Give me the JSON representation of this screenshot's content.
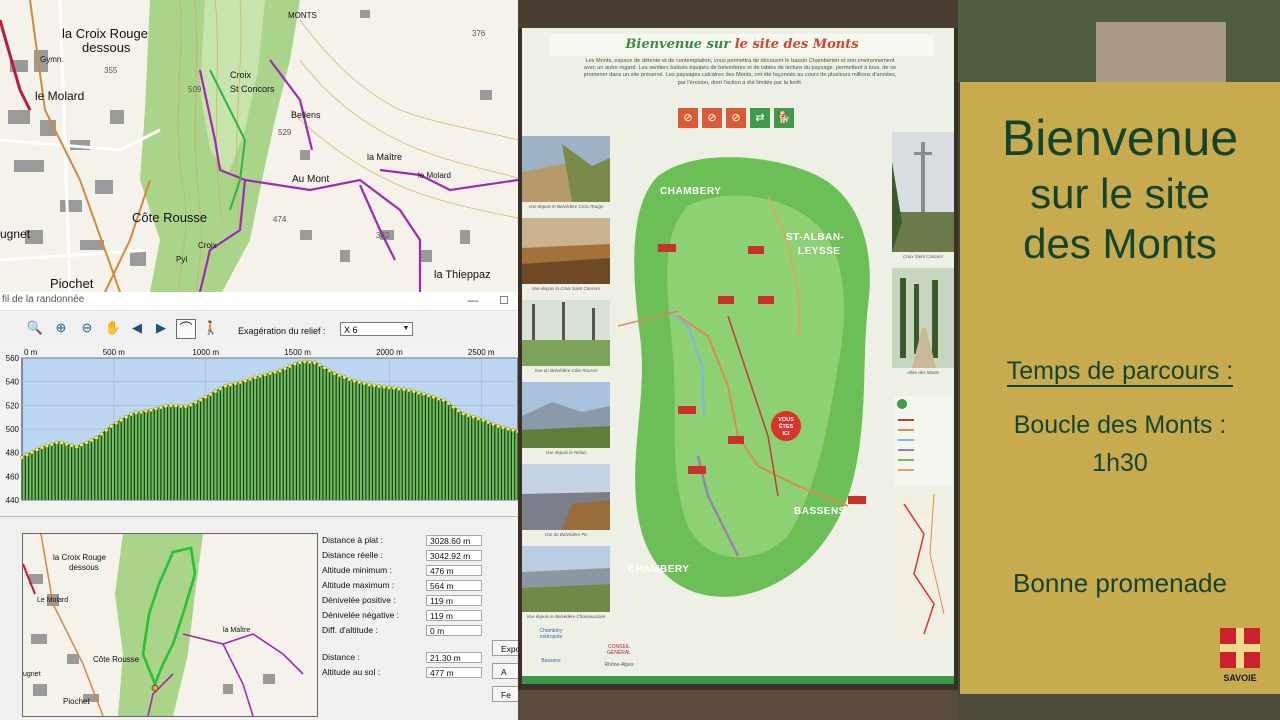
{
  "window": {
    "title": "fil de la randonnée"
  },
  "topmap": {
    "labels": [
      "la Croix Rouge",
      "dessous",
      "le Molard",
      "Croix",
      "St Concors",
      "Bellens",
      "la Maître",
      "Au Mont",
      "le Molard",
      "Côte Rousse",
      "Croix",
      "Pyl",
      "Piochet",
      "la Thieppaz",
      "Gymn.",
      "MONTS",
      "ugnet"
    ],
    "elevations": [
      "355",
      "375",
      "376",
      "509",
      "529",
      "474",
      "382",
      "290",
      "300"
    ]
  },
  "toolbar": {
    "exag_label": "Exagération du relief :",
    "exag_value": "X 6",
    "icons": [
      "zoom-in-icon",
      "zoom-region-icon",
      "zoom-out-icon",
      "pan-hand-icon",
      "arrow-left-icon",
      "arrow-right-icon",
      "profile-mode-icon",
      "walker-icon"
    ]
  },
  "chart_data": {
    "type": "area",
    "x_unit": "m",
    "y_unit": "m",
    "x_ticks": [
      "0 m",
      "500 m",
      "1000 m",
      "1500 m",
      "2000 m",
      "2500 m"
    ],
    "y_ticks": [
      "560",
      "540",
      "520",
      "500",
      "480",
      "460",
      "440"
    ],
    "ylim": [
      440,
      560
    ],
    "xlim": [
      0,
      2700
    ],
    "series": [
      {
        "x": [
          0,
          100,
          200,
          300,
          400,
          500,
          600,
          700,
          800,
          900,
          1000,
          1100,
          1200,
          1300,
          1400,
          1500,
          1550,
          1600,
          1700,
          1800,
          1900,
          2000,
          2100,
          2200,
          2300,
          2400,
          2500,
          2600,
          2700
        ],
        "y": [
          476,
          484,
          489,
          485,
          492,
          504,
          513,
          516,
          520,
          519,
          527,
          536,
          540,
          545,
          549,
          556,
          557,
          556,
          547,
          541,
          537,
          535,
          533,
          529,
          524,
          513,
          508,
          502,
          498
        ]
      }
    ],
    "fill_color": "#6fbd5e",
    "point_color": "#f3f05a",
    "background": "#bcd6f2",
    "grid": true
  },
  "stats": [
    {
      "label": "Distance à plat :",
      "value": "3028.60 m"
    },
    {
      "label": "Distance réelle :",
      "value": "3042.92 m"
    },
    {
      "label": "Altitude minimum :",
      "value": "476 m"
    },
    {
      "label": "Altitude maximum :",
      "value": "564 m"
    },
    {
      "label": "Dénivelée positive :",
      "value": "119 m"
    },
    {
      "label": "Dénivelée négative :",
      "value": "119 m"
    },
    {
      "label": "Diff. d'altitude :",
      "value": "0 m"
    }
  ],
  "cursor": [
    {
      "label": "Distance :",
      "value": "21.30 m"
    },
    {
      "label": "Altitude au sol :",
      "value": "477 m"
    }
  ],
  "side_buttons": [
    "Expo",
    "A",
    "A",
    "Fe"
  ],
  "minimap": {
    "labels": [
      "la Croix Rouge",
      "dessous",
      "Le Molard",
      "Côte Rousse",
      "Piochet",
      "la Maître",
      "ugnet"
    ]
  },
  "board": {
    "title_part1": "Bienvenue sur",
    "title_part2": "le site des Monts",
    "intro": "Les Monts, espace de détente et de contemplation, vous permettra de découvrir le bassin Chambérien et son environnement avec un autre regard. Les sentiers balisés équipés de belvédères et de tables de lecture du paysage, permettent à tous, de se promener dans un site préservé. Les paysages calcaires des Monts, ont été façonnés au cours de plusieurs millions d'années, par l'érosion, dont l'action a été limitée par la forêt.",
    "map_labels": [
      "CHAMBERY",
      "ST-ALBAN-",
      "LEYSSE",
      "BASSENS",
      "CHAMBERY"
    ],
    "you_are_here_1": "VOUS",
    "you_are_here_2": "ÊTES",
    "you_are_here_3": "ICI",
    "captions_left": [
      "Vue depuis le Belvédère Croix Rouge",
      "Vue depuis la Croix Saint Concors",
      "Vue du Belvédère Côte Rousse",
      "Vue depuis le Relais",
      "Vue du Belvédère Pic",
      "Vue depuis le Belvédère Chamoussaire"
    ],
    "captions_right": [
      "Croix Saint Concors",
      "Allée des Monts"
    ],
    "logos": [
      "Chambéry métropole",
      "Bassens",
      "CONSEIL GÉNÉRAL",
      "Rhône-Alpes"
    ]
  },
  "sign": {
    "line1": "Bienvenue",
    "line2": "sur le site",
    "line3": "des Monts",
    "heading": "Temps de parcours :",
    "route": "Boucle des Monts :",
    "time": "1h30",
    "farewell": "Bonne promenade",
    "logo_text": "SAVOIE"
  }
}
